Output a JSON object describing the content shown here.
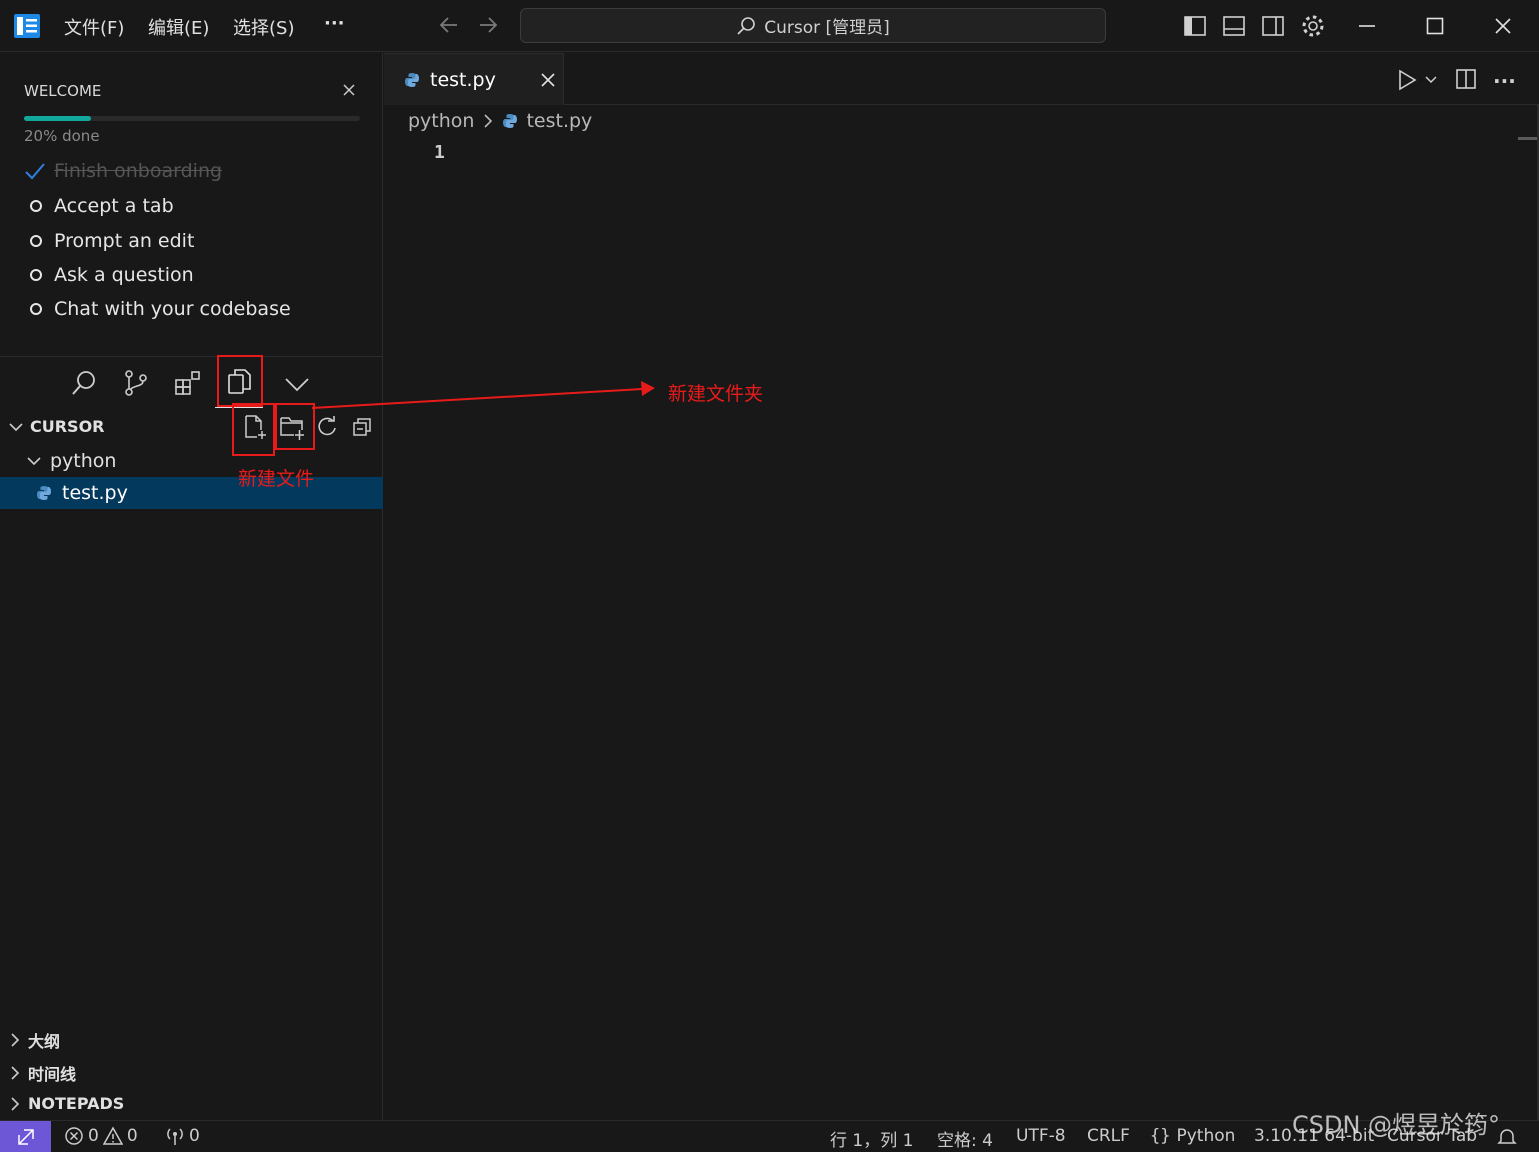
{
  "titlebar": {
    "menus": [
      "文件(F)",
      "编辑(E)",
      "选择(S)",
      "···"
    ],
    "search_text": "Cursor [管理员]"
  },
  "welcome": {
    "title": "WELCOME",
    "progress_text": "20% done",
    "progress_fraction": 0.2,
    "items": [
      {
        "label": "Finish onboarding",
        "done": true
      },
      {
        "label": "Accept a tab",
        "done": false
      },
      {
        "label": "Prompt an edit",
        "done": false
      },
      {
        "label": "Ask a question",
        "done": false
      },
      {
        "label": "Chat with your codebase",
        "done": false
      }
    ]
  },
  "explorer": {
    "root": "CURSOR",
    "folder": "python",
    "file": "test.py",
    "sections": [
      "大纲",
      "时间线",
      "NOTEPADS"
    ]
  },
  "editor": {
    "tab_label": "test.py",
    "breadcrumb_folder": "python",
    "breadcrumb_file": "test.py",
    "line_number": "1"
  },
  "annotations": {
    "new_folder": "新建文件夹",
    "new_file": "新建文件"
  },
  "statusbar": {
    "errors": "0",
    "warnings": "0",
    "ports": "0",
    "position": "行 1，列 1",
    "spaces": "空格: 4",
    "encoding": "UTF-8",
    "eol": "CRLF",
    "language": "Python",
    "interpreter": "3.10.11 64-bit",
    "cursor_tab": "Cursor Tab",
    "watermark": "CSDN @煜昱於筠°"
  },
  "colors": {
    "accent": "#0078d4",
    "progress": "#13a89e",
    "annotation": "#e81b1b",
    "selection": "#04395e",
    "remote": "#6e57d6"
  }
}
